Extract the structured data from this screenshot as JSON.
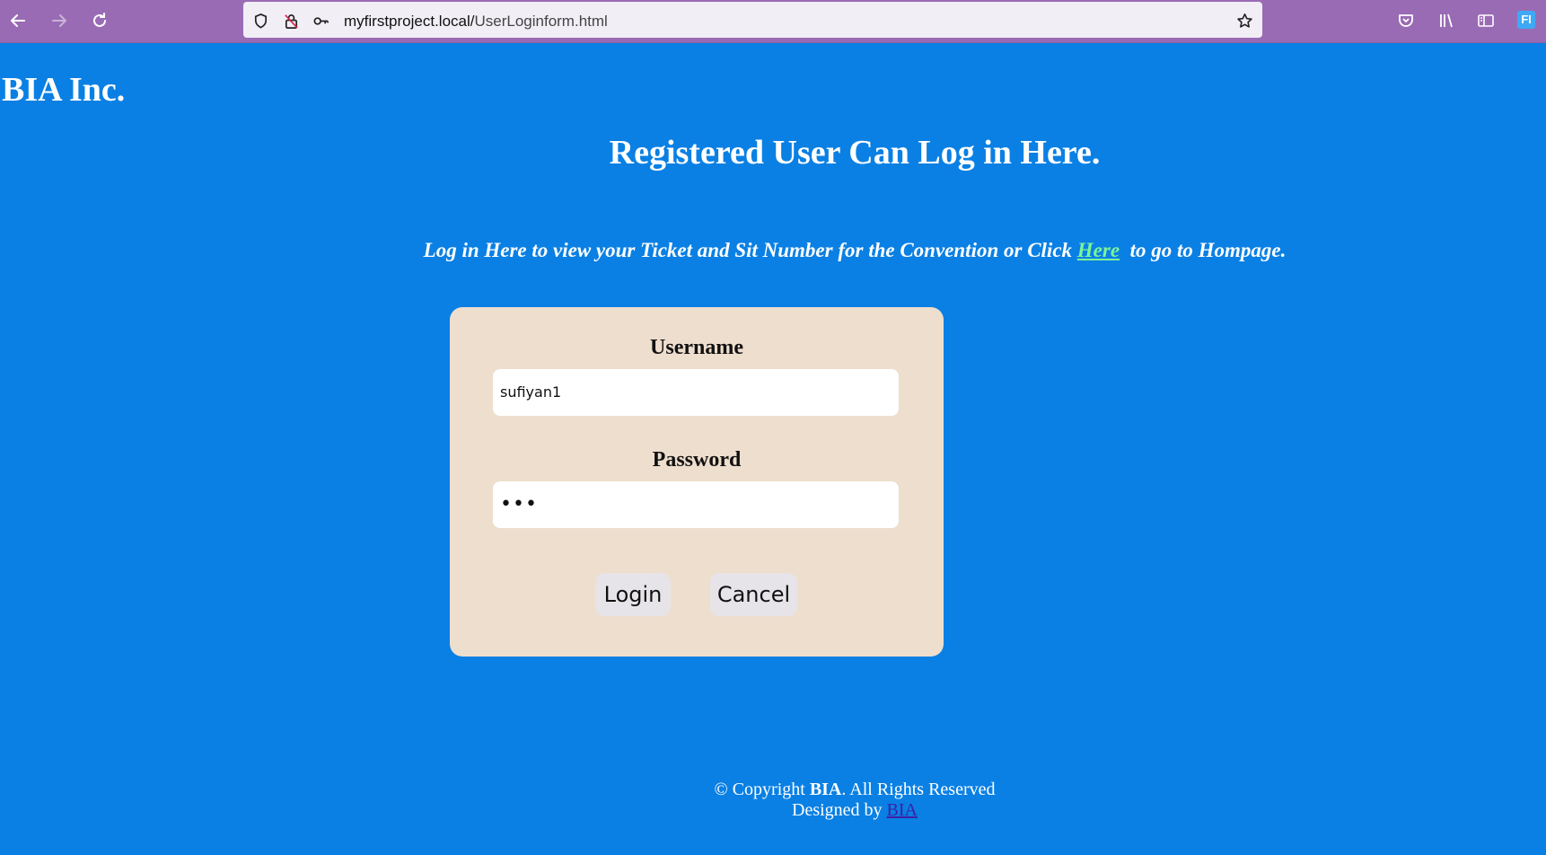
{
  "browser": {
    "url_host": "myfirstproject.local/",
    "url_path": "UserLoginform.html",
    "profile_initials": "FI"
  },
  "page": {
    "brand": "BIA Inc.",
    "heading": "Registered User Can Log in Here.",
    "intro_before": "Log in Here to view your Ticket and Sit Number for the Convention or Click ",
    "intro_link": "Here",
    "intro_after": "  to go to Hompage."
  },
  "form": {
    "username_label": "Username",
    "username_value": "sufiyan1",
    "password_label": "Password",
    "password_value": "•••",
    "login_label": "Login",
    "cancel_label": "Cancel"
  },
  "footer": {
    "copyright_prefix": "© Copyright ",
    "copyright_brand": "BIA",
    "copyright_suffix": ". All Rights Reserved",
    "designed_by": "Designed by ",
    "designer_link": "BIA"
  }
}
